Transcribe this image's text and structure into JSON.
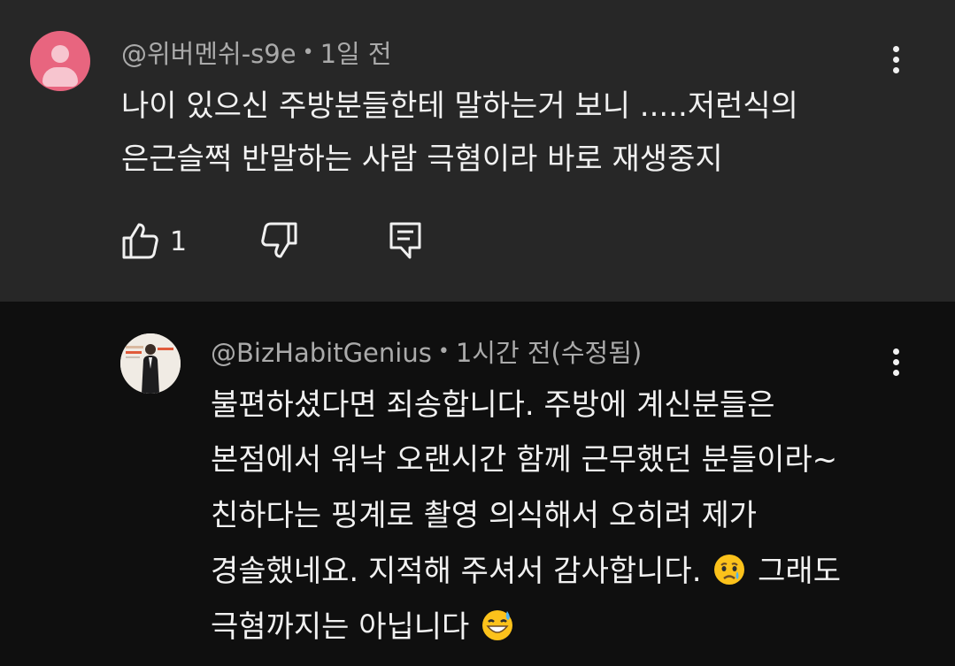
{
  "top_comment": {
    "author": "@위버멘쉬-s9e",
    "separator": "•",
    "time": "1일 전",
    "lines": [
      "나이 있으신 주방분들한테 말하는거 보니 .....저런식의",
      "은근슬쩍 반말하는 사람 극혐이라 바로 재생중지"
    ],
    "like_count": "1"
  },
  "reply": {
    "author": "@BizHabitGenius",
    "separator": "•",
    "time": "1시간 전(수정됨)",
    "lines": [
      "불편하셨다면 죄송합니다. 주방에 계신분들은",
      "본점에서 워낙 오랜시간 함께 근무했던 분들이라~",
      "친하다는 핑계로 촬영 의식해서 오히려 제가"
    ],
    "line4_a": "경솔했네요. 지적해 주셔서 감사합니다.",
    "line4_b": "그래도",
    "line5_a": "극혐까지는 아닙니다",
    "emoji_1": "crying-face-emoji",
    "emoji_2": "sweat-smile-emoji"
  },
  "colors": {
    "top_background": "#272727",
    "reply_background": "#0f0f0f",
    "text": "#f1f1f1",
    "meta": "#aaaaaa",
    "default_avatar": "#e8657f"
  }
}
